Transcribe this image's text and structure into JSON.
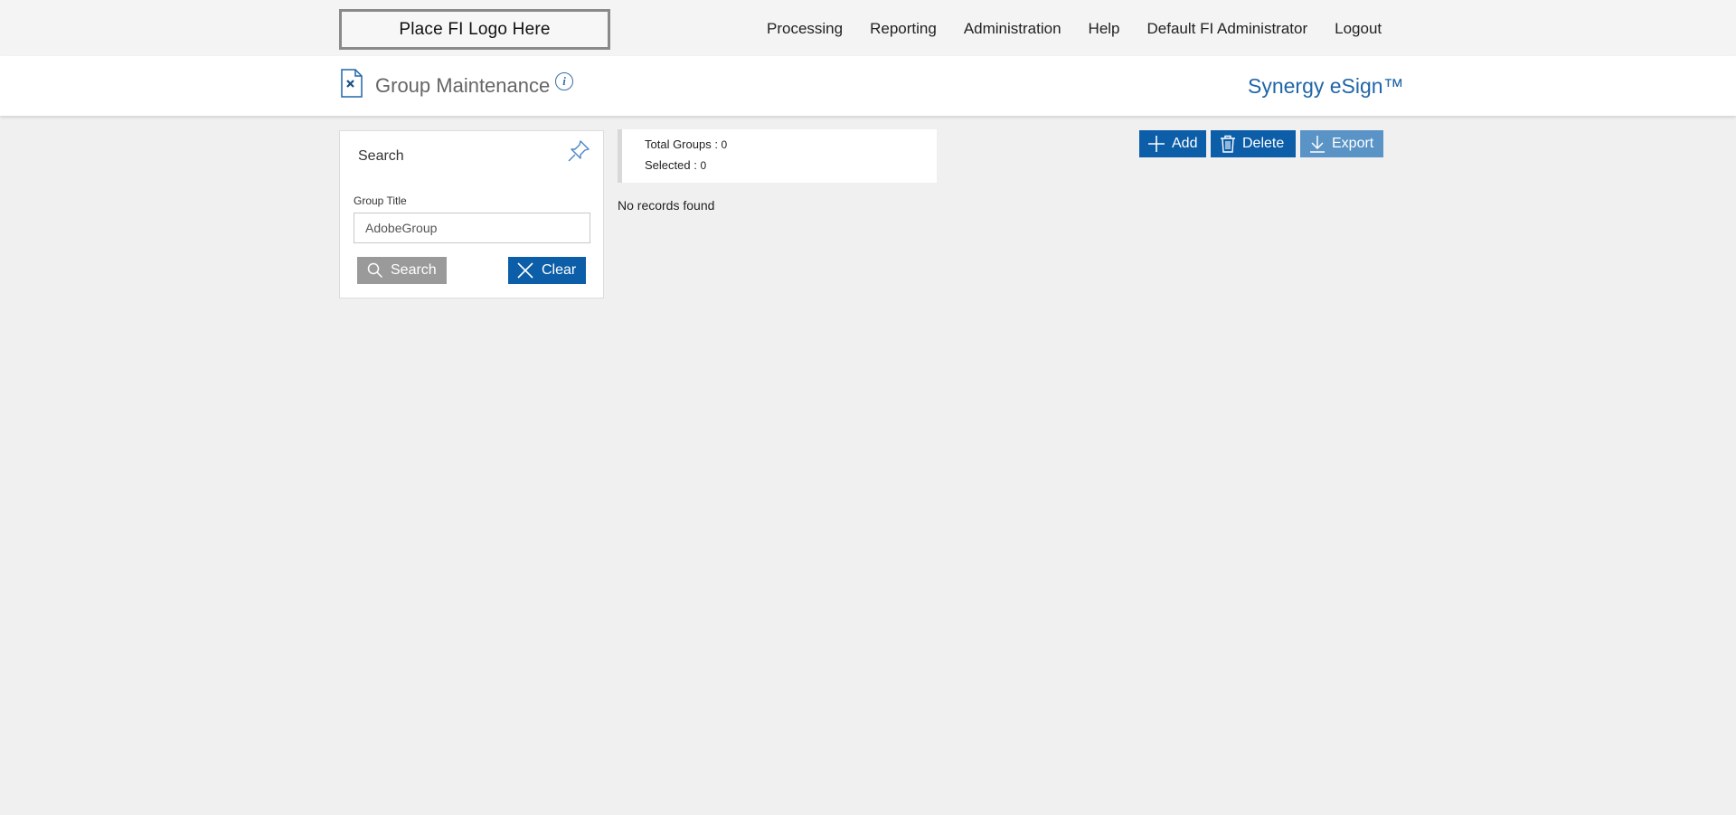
{
  "header": {
    "logo_text": "Place FI Logo Here",
    "nav": [
      "Processing",
      "Reporting",
      "Administration",
      "Help",
      "Default FI Administrator",
      "Logout"
    ]
  },
  "title_bar": {
    "page_title": "Group Maintenance",
    "info_icon": "i",
    "brand": "Synergy eSign™"
  },
  "search_panel": {
    "title": "Search",
    "field_label": "Group Title",
    "field_value": "AdobeGroup",
    "search_button": "Search",
    "clear_button": "Clear"
  },
  "stats": {
    "total_label": "Total Groups : ",
    "total_value": "0",
    "selected_label": "Selected : ",
    "selected_value": "0"
  },
  "results": {
    "empty_message": "No records found"
  },
  "actions": {
    "add": "Add",
    "delete": "Delete",
    "export": "Export"
  },
  "colors": {
    "primary": "#0c5ea8",
    "export_button": "#5a93c6",
    "search_button": "#9a9a9a",
    "brand": "#2166a8",
    "background": "#f0f0f0"
  },
  "icons": [
    "document-icon",
    "info-icon",
    "pin-icon",
    "search-icon",
    "close-icon",
    "plus-icon",
    "trash-icon",
    "download-icon"
  ]
}
